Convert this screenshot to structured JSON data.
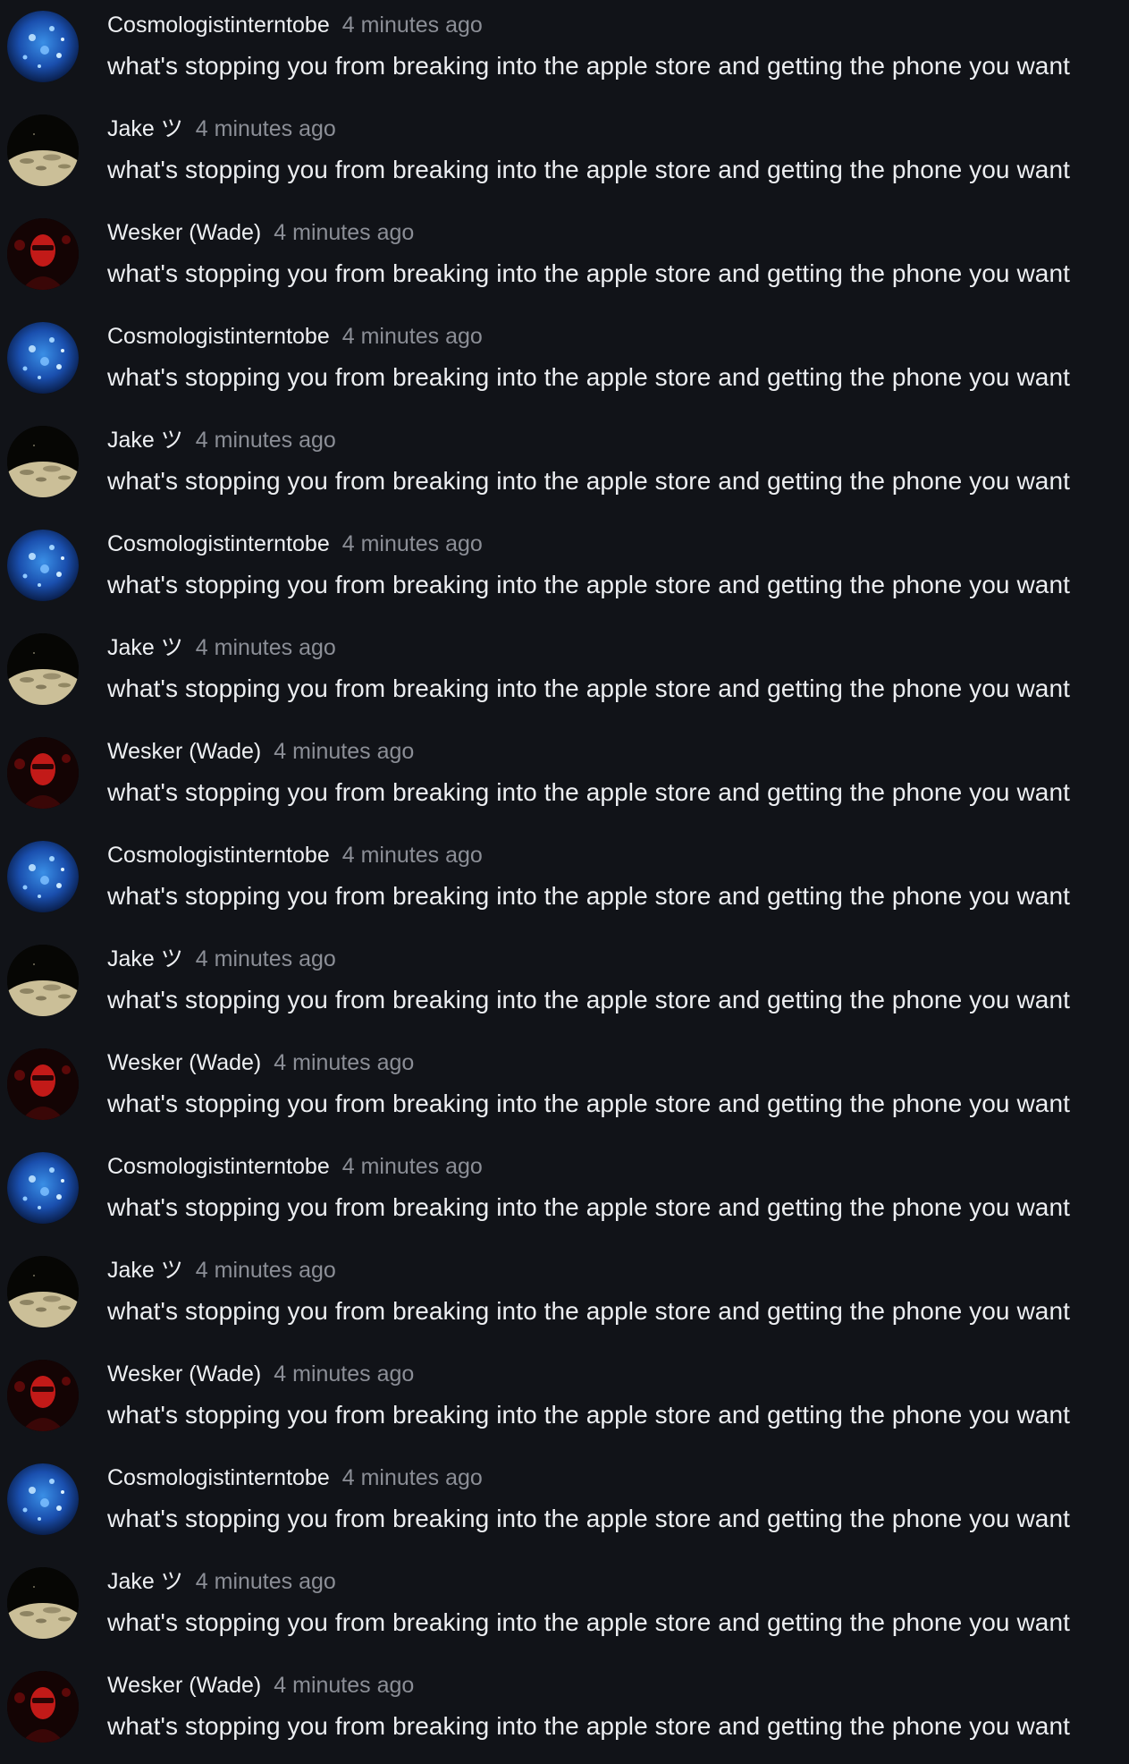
{
  "messages": [
    {
      "author": "Cosmologistinterntobe",
      "time": "4 minutes ago",
      "text": "what's stopping you from breaking into the apple store and getting the phone you want",
      "avatar": "space-avatar"
    },
    {
      "author": "Jake ツ",
      "time": "4 minutes ago",
      "text": "what's stopping you from breaking into the apple store and getting the phone you want",
      "avatar": "moon-avatar"
    },
    {
      "author": "Wesker (Wade)",
      "time": "4 minutes ago",
      "text": "what's stopping you from breaking into the apple store and getting the phone you want",
      "avatar": "red-figure-avatar"
    },
    {
      "author": "Cosmologistinterntobe",
      "time": "4 minutes ago",
      "text": "what's stopping you from breaking into the apple store and getting the phone you want",
      "avatar": "space-avatar"
    },
    {
      "author": "Jake ツ",
      "time": "4 minutes ago",
      "text": "what's stopping you from breaking into the apple store and getting the phone you want",
      "avatar": "moon-avatar"
    },
    {
      "author": "Cosmologistinterntobe",
      "time": "4 minutes ago",
      "text": "what's stopping you from breaking into the apple store and getting the phone you want",
      "avatar": "space-avatar"
    },
    {
      "author": "Jake ツ",
      "time": "4 minutes ago",
      "text": "what's stopping you from breaking into the apple store and getting the phone you want",
      "avatar": "moon-avatar"
    },
    {
      "author": "Wesker (Wade)",
      "time": "4 minutes ago",
      "text": "what's stopping you from breaking into the apple store and getting the phone you want",
      "avatar": "red-figure-avatar"
    },
    {
      "author": "Cosmologistinterntobe",
      "time": "4 minutes ago",
      "text": "what's stopping you from breaking into the apple store and getting the phone you want",
      "avatar": "space-avatar"
    },
    {
      "author": "Jake ツ",
      "time": "4 minutes ago",
      "text": "what's stopping you from breaking into the apple store and getting the phone you want",
      "avatar": "moon-avatar"
    },
    {
      "author": "Wesker (Wade)",
      "time": "4 minutes ago",
      "text": "what's stopping you from breaking into the apple store and getting the phone you want",
      "avatar": "red-figure-avatar"
    },
    {
      "author": "Cosmologistinterntobe",
      "time": "4 minutes ago",
      "text": "what's stopping you from breaking into the apple store and getting the phone you want",
      "avatar": "space-avatar"
    },
    {
      "author": "Jake ツ",
      "time": "4 minutes ago",
      "text": "what's stopping you from breaking into the apple store and getting the phone you want",
      "avatar": "moon-avatar"
    },
    {
      "author": "Wesker (Wade)",
      "time": "4 minutes ago",
      "text": "what's stopping you from breaking into the apple store and getting the phone you want",
      "avatar": "red-figure-avatar"
    },
    {
      "author": "Cosmologistinterntobe",
      "time": "4 minutes ago",
      "text": "what's stopping you from breaking into the apple store and getting the phone you want",
      "avatar": "space-avatar"
    },
    {
      "author": "Jake ツ",
      "time": "4 minutes ago",
      "text": "what's stopping you from breaking into the apple store and getting the phone you want",
      "avatar": "moon-avatar"
    },
    {
      "author": "Wesker (Wade)",
      "time": "4 minutes ago",
      "text": "what's stopping you from breaking into the apple store and getting the phone you want",
      "avatar": "red-figure-avatar"
    }
  ],
  "colors": {
    "background": "#111318",
    "author": "#eef0f3",
    "timestamp": "#8b8e96",
    "message": "#eceef1"
  }
}
